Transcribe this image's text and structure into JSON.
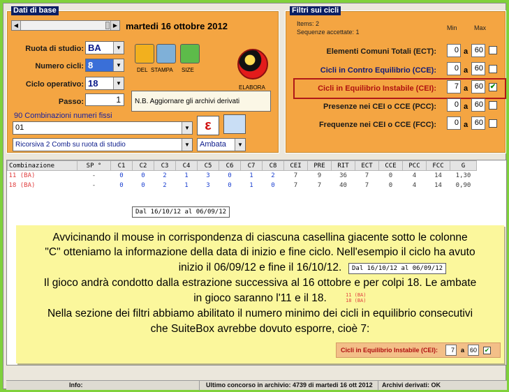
{
  "base_panel": {
    "title": "Dati di base",
    "date": "martedi 16 ottobre 2012",
    "ruota_label": "Ruota di studio:",
    "ruota_value": "BA",
    "numero_cicli_label": "Numero cicli:",
    "numero_cicli_value": "8",
    "ciclo_operativo_label": "Ciclo operativo:",
    "ciclo_operativo_value": "18",
    "passo_label": "Passo:",
    "passo_value": "1",
    "tools": {
      "del": "DEL",
      "stampa": "STAMPA",
      "size": "SIZE",
      "elabora": "ELABORA"
    },
    "note": "N.B. Aggiornare gli archivi derivati",
    "combos_title": "90 Combinazioni numeri fissi",
    "combo_select": "01",
    "ricorsiva_select": "Ricorsiva 2 Comb su ruota di studio",
    "ambata_select": "Ambata",
    "epsilon": "ε"
  },
  "filters_panel": {
    "title": "Filtri sui cicli",
    "items": "Items: 2",
    "sequenze": "Sequenze accettate: 1",
    "min_header": "Min",
    "max_header": "Max",
    "a": "a",
    "rows": [
      {
        "label": "Elementi Comuni Totali (ECT):",
        "min": "0",
        "max": "60",
        "checked": ""
      },
      {
        "label": "Cicli in Contro Equilibrio (CCE):",
        "min": "0",
        "max": "60",
        "checked": ""
      },
      {
        "label": "Cicli in Equilibrio Instabile (CEI):",
        "min": "7",
        "max": "60",
        "checked": "✔"
      },
      {
        "label": "Presenze nei CEI o CCE (PCC):",
        "min": "0",
        "max": "60",
        "checked": ""
      },
      {
        "label": "Frequenze nei CEI o CCE (FCC):",
        "min": "0",
        "max": "60",
        "checked": ""
      }
    ]
  },
  "table": {
    "headers": [
      "Combinazione",
      "SP °",
      "C1",
      "C2",
      "C3",
      "C4",
      "C5",
      "C6",
      "C7",
      "C8",
      "CEI",
      "PRE",
      "RIT",
      "ECT",
      "CCE",
      "PCC",
      "FCC",
      "G"
    ],
    "rows": [
      [
        "11  (BA)",
        "-",
        "0",
        "0",
        "2",
        "1",
        "3",
        "0",
        "1",
        "2",
        "7",
        "9",
        "36",
        "7",
        "0",
        "4",
        "14",
        "1,30"
      ],
      [
        "18  (BA)",
        "-",
        "0",
        "0",
        "2",
        "1",
        "3",
        "0",
        "1",
        "0",
        "7",
        "7",
        "40",
        "7",
        "0",
        "4",
        "14",
        "0,90"
      ]
    ],
    "tooltip": "Dal 16/10/12 al 06/09/12"
  },
  "explanation": {
    "line1": "Avvicinando il mouse in corrispondenza di ciascuna casellina giacente sotto le colonne",
    "line2": "\"C\" otteniamo la informazione della data di inizio e fine ciclo. Nell'esempio il ciclo ha avuto",
    "line3": "inizio il 06/09/12 e fine il 16/10/12.",
    "line3_tip": "Dal 16/10/12 al 06/09/12",
    "line4": "Il gioco andrà condotto dalla estrazione successiva al 16 ottobre e per colpi 18. Le ambate",
    "line5": "in gioco saranno l'11 e il 18.",
    "mini_row1": "11  (BA)",
    "mini_row2": "18  (BA)",
    "line6": "Nella sezione dei filtri abbiamo abilitato il numero minimo dei cicli in equilibrio consecutivi",
    "line7": "che SuiteBox avrebbe dovuto esporre, cioè 7:",
    "mini_filter_label": "Cicli in Equilibrio Instabile (CEI):",
    "mini_filter_min": "7",
    "mini_filter_a": "a",
    "mini_filter_max": "60",
    "mini_filter_check": "✔"
  },
  "status_bar": {
    "info": "Info:",
    "ultimo": "Ultimo concorso in archivio: 4739 di martedi 16 ott 2012",
    "archivi": "Archivi derivati: OK"
  },
  "colors": {
    "panel": "#f4a542",
    "title_bar": "#0b1e63",
    "background": "#7fd13b",
    "explanation": "#fbf79c",
    "highlight": "#b01818"
  }
}
